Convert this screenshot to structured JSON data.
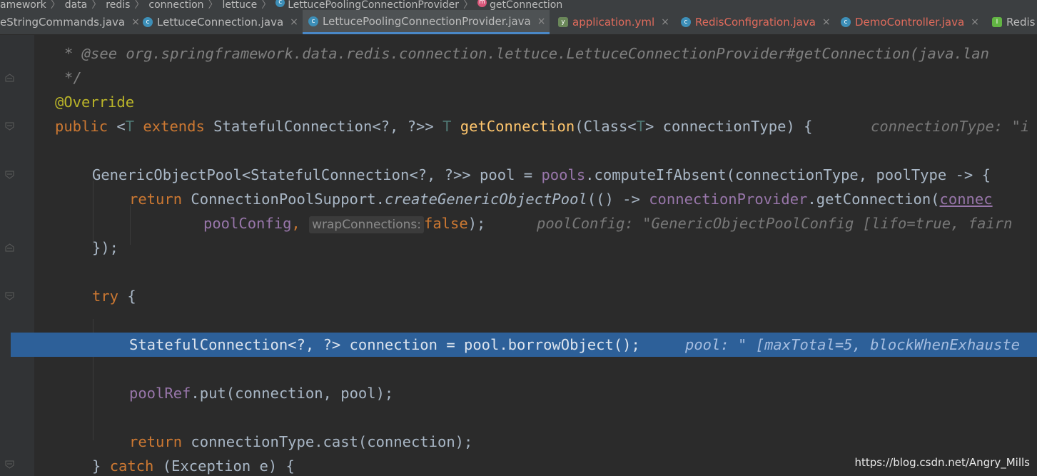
{
  "breadcrumb": {
    "items": [
      "amework",
      "data",
      "redis",
      "connection",
      "lettuce",
      "LettucePoolingConnectionProvider",
      "getConnection"
    ],
    "sep": "〉"
  },
  "tabs": [
    {
      "label": "eStringCommands.java",
      "icon": "class-icon",
      "active": false,
      "modified": false
    },
    {
      "label": "LettuceConnection.java",
      "icon": "class-icon",
      "active": false,
      "modified": false
    },
    {
      "label": "LettucePoolingConnectionProvider.java",
      "icon": "class-icon",
      "active": true,
      "modified": false
    },
    {
      "label": "application.yml",
      "icon": "yml-icon",
      "active": false,
      "modified": true
    },
    {
      "label": "RedisConfigration.java",
      "icon": "class-icon",
      "active": false,
      "modified": true
    },
    {
      "label": "DemoController.java",
      "icon": "class-icon",
      "active": false,
      "modified": true
    },
    {
      "label": "Redis",
      "icon": "interface-icon",
      "active": false,
      "modified": false
    }
  ],
  "tab_close_glyph": "×",
  "code": {
    "l1": "* @see org.springframework.data.redis.connection.lettuce.LettuceConnectionProvider#getConnection(java.lan",
    "l2": "*/",
    "l3": "@Override",
    "l4": {
      "a": "public",
      "b": " <",
      "c": "T",
      "d": " extends",
      "e": " StatefulConnection<?, ?>> ",
      "f": "T",
      "g": " ",
      "h": "getConnection",
      "i": "(Class<",
      "j": "T",
      "k": "> connectionType) {",
      "hint": "connectionType: \"i"
    },
    "l5": {
      "a": "GenericObjectPool<StatefulConnection<?, ?>> pool = ",
      "b": "pools",
      "c": ".computeIfAbsent(connectionType, poolType -> {"
    },
    "l6": {
      "a": "return",
      "b": " ConnectionPoolSupport.",
      "c": "createGenericObjectPool",
      "d": "(() -> ",
      "e": "connectionProvider",
      "f": ".getConnection(",
      "g": "connec"
    },
    "l7": {
      "a": "poolConfig",
      "b": ", ",
      "pill": "wrapConnections:",
      "c": "false",
      "d": ");",
      "hint": "poolConfig: \"GenericObjectPoolConfig [lifo=true, fairn"
    },
    "l8": "});",
    "l9": {
      "a": "try",
      "b": " {"
    },
    "l10": {
      "a": "StatefulConnection<?, ?> connection = pool.borrowObject();",
      "hint": "pool: \" [maxTotal=5, blockWhenExhauste"
    },
    "l11": {
      "a": "poolRef",
      "b": ".put(connection, pool);"
    },
    "l12": {
      "a": "return",
      "b": " connectionType.cast(connection);"
    },
    "l13": {
      "a": "} ",
      "b": "catch",
      "c": " (Exception e) {"
    }
  },
  "watermark": "https://blog.csdn.net/Angry_Mills",
  "colors": {
    "background": "#2b2b2b",
    "keyword": "#cc7832",
    "annotation": "#bbb529",
    "method": "#ffc66d",
    "field": "#9876aa",
    "selection": "#2d6099"
  }
}
